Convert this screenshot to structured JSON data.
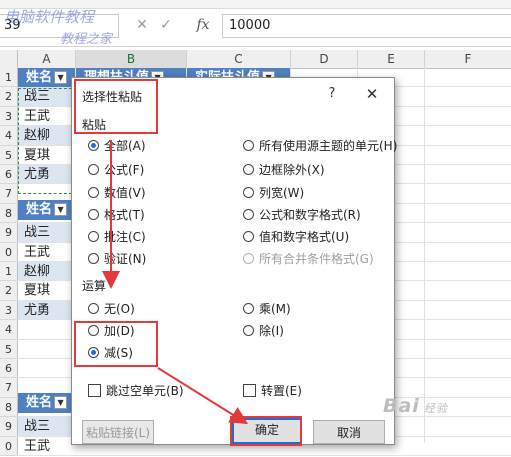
{
  "formula_bar": {
    "name_box": "39",
    "cancel_glyph": "✕",
    "enter_glyph": "✓",
    "fx_label": "fx",
    "value": "10000",
    "watermark_top": "电脑软件教程",
    "watermark_bottom": "教程之家"
  },
  "columns": [
    "A",
    "B",
    "C",
    "D",
    "E",
    "F"
  ],
  "row_numbers": [
    "1",
    "2",
    "3",
    "4",
    "5",
    "6",
    "7",
    "8",
    "9",
    "0",
    "1",
    "2",
    "3",
    "4",
    "5",
    "6",
    "7",
    "8",
    "9",
    "0"
  ],
  "table1": {
    "header_a": "姓名",
    "header_b": "理想扶斗值",
    "header_c": "实际扶斗值",
    "names": [
      "战三",
      "王武",
      "赵柳",
      "夏琪",
      "尤勇"
    ]
  },
  "table2": {
    "header_a": "姓名",
    "names": [
      "战三",
      "王武",
      "赵柳",
      "夏琪",
      "尤勇"
    ]
  },
  "table3": {
    "header_a": "姓名",
    "names": [
      "战三",
      "王武"
    ]
  },
  "dialog": {
    "title": "选择性粘贴",
    "help_glyph": "?",
    "close_glyph": "✕",
    "paste_section": "粘贴",
    "paste_left": [
      "全部(A)",
      "公式(F)",
      "数值(V)",
      "格式(T)",
      "批注(C)",
      "验证(N)"
    ],
    "paste_right": [
      "所有使用源主题的单元(H)",
      "边框除外(X)",
      "列宽(W)",
      "公式和数字格式(R)",
      "值和数字格式(U)",
      "所有合并条件格式(G)"
    ],
    "operation_section": "运算",
    "op_left": [
      "无(O)",
      "加(D)",
      "减(S)"
    ],
    "op_right": [
      "乘(M)",
      "除(I)"
    ],
    "skip_blanks": "跳过空单元(B)",
    "transpose": "转置(E)",
    "paste_link_button": "粘贴链接(L)",
    "ok_button": "确定",
    "cancel_button": "取消"
  },
  "watermark_baidu": "Bai",
  "watermark_baidu_small": "经验",
  "colors": {
    "header_blue": "#4f80c2",
    "band_blue": "#dce6f1",
    "annotation_red": "#e03a3a",
    "radio_blue": "#1b6fd8"
  }
}
